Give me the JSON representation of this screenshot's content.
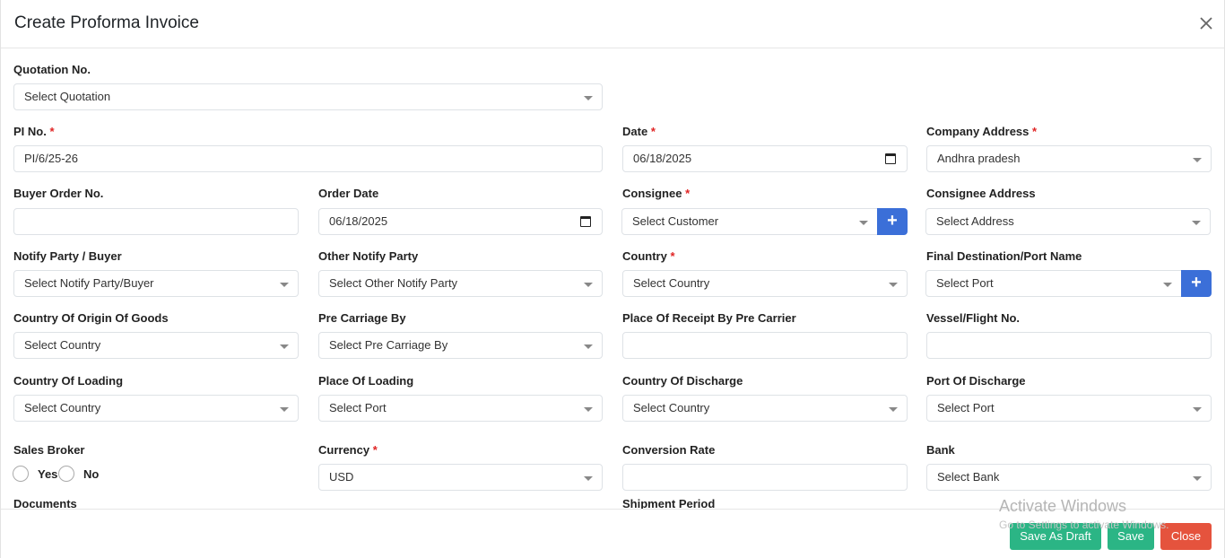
{
  "modal": {
    "title": "Create Proforma Invoice"
  },
  "fields": {
    "quotation_no": {
      "label": "Quotation No.",
      "value": "Select Quotation"
    },
    "pi_no": {
      "label": "PI No.",
      "required": "*",
      "value": "PI/6/25-26"
    },
    "date": {
      "label": "Date",
      "required": "*",
      "value": "06/18/2025"
    },
    "company_address": {
      "label": "Company Address",
      "required": "*",
      "value": "Andhra pradesh"
    },
    "buyer_order_no": {
      "label": "Buyer Order No.",
      "value": ""
    },
    "order_date": {
      "label": "Order Date",
      "value": "06/18/2025"
    },
    "consignee": {
      "label": "Consignee",
      "required": "*",
      "value": "Select Customer",
      "add": "+"
    },
    "consignee_address": {
      "label": "Consignee Address",
      "value": "Select Address"
    },
    "notify_party": {
      "label": "Notify Party / Buyer",
      "value": "Select Notify Party/Buyer"
    },
    "other_notify_party": {
      "label": "Other Notify Party",
      "value": "Select Other Notify Party"
    },
    "country": {
      "label": "Country",
      "required": "*",
      "value": "Select Country"
    },
    "final_destination": {
      "label": "Final Destination/Port Name",
      "value": "Select Port",
      "add": "+"
    },
    "country_of_origin": {
      "label": "Country Of Origin Of Goods",
      "value": "Select Country"
    },
    "pre_carriage_by": {
      "label": "Pre Carriage By",
      "value": "Select Pre Carriage By"
    },
    "place_of_receipt": {
      "label": "Place Of Receipt By Pre Carrier",
      "value": ""
    },
    "vessel_flight": {
      "label": "Vessel/Flight No.",
      "value": ""
    },
    "country_of_loading": {
      "label": "Country Of Loading",
      "value": "Select Country"
    },
    "place_of_loading": {
      "label": "Place Of Loading",
      "value": "Select Port"
    },
    "country_of_discharge": {
      "label": "Country Of Discharge",
      "value": "Select Country"
    },
    "port_of_discharge": {
      "label": "Port Of Discharge",
      "value": "Select Port"
    },
    "sales_broker": {
      "label": "Sales Broker",
      "yes": "Yes",
      "no": "No"
    },
    "currency": {
      "label": "Currency",
      "required": "*",
      "value": "USD"
    },
    "conversion_rate": {
      "label": "Conversion Rate",
      "value": ""
    },
    "bank": {
      "label": "Bank",
      "value": "Select Bank"
    },
    "documents": {
      "label": "Documents"
    },
    "shipment_period": {
      "label": "Shipment Period"
    }
  },
  "footer": {
    "save_draft": "Save As Draft",
    "save": "Save",
    "close": "Close"
  },
  "watermark": {
    "line1": "Activate Windows",
    "line2": "Go to Settings to activate Windows."
  },
  "colors": {
    "primary": "#3b6fd8",
    "success": "#2bb585",
    "danger": "#e5533d",
    "required": "#e02424"
  },
  "icons": {
    "close": "close-icon",
    "dropdown": "chevron-down-icon",
    "calendar": "calendar-icon",
    "add": "plus-icon"
  }
}
